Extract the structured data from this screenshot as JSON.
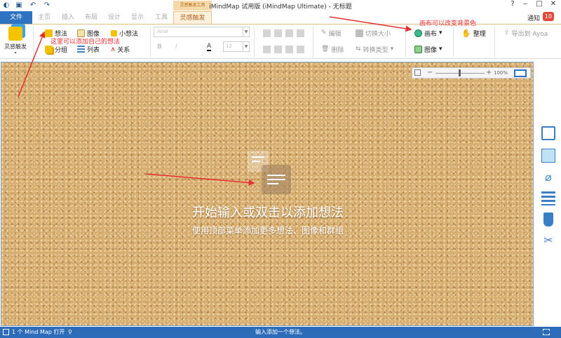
{
  "window": {
    "title": "iMindMap 试用版 (iMindMap Ultimate) - 无标题",
    "context_tab_group": "灵感触发工具",
    "help": "?",
    "minimize": "‒",
    "maximize": "□",
    "close": "✕"
  },
  "tabs": [
    {
      "label": "文件"
    },
    {
      "label": "主页"
    },
    {
      "label": "插入"
    },
    {
      "label": "布局"
    },
    {
      "label": "设计"
    },
    {
      "label": "显示"
    },
    {
      "label": "工具"
    },
    {
      "label": "灵感触发"
    }
  ],
  "notify": {
    "label": "通知",
    "count": "10"
  },
  "ribbon": {
    "brainstorm_label": "灵感触发",
    "idea": "想法",
    "image": "图像",
    "small_idea": "小想法",
    "group": "分组",
    "list": "列表",
    "relation": "关系",
    "font_placeholder": "Arial",
    "font_size": "12",
    "bold": "B",
    "italic": "I",
    "text_color": "A",
    "edit": "编辑",
    "toggle_size": "切换大小",
    "delete": "删除",
    "convert_type": "转换类型",
    "canvas": "画布",
    "canvas_image": "图像",
    "tidy": "整理",
    "export": "导出到 Ayoa"
  },
  "annotations": {
    "add_idea": "这里可以添加自己的想法",
    "change_bg": "画布可以改变背景色"
  },
  "canvas": {
    "hint_title": "开始输入或双击以添加想法",
    "hint_sub": "使用顶部菜单添加更多想法、图像和群组",
    "zoom_level": "100%"
  },
  "status": {
    "open_maps": "1 个 Mind Map 打开",
    "message": "输入添加一个想法。"
  },
  "colors": {
    "accent_blue": "#2e73c2",
    "tab_orange": "#b5651d",
    "annotation_red": "#e53030",
    "cork": "#d7ae72"
  }
}
